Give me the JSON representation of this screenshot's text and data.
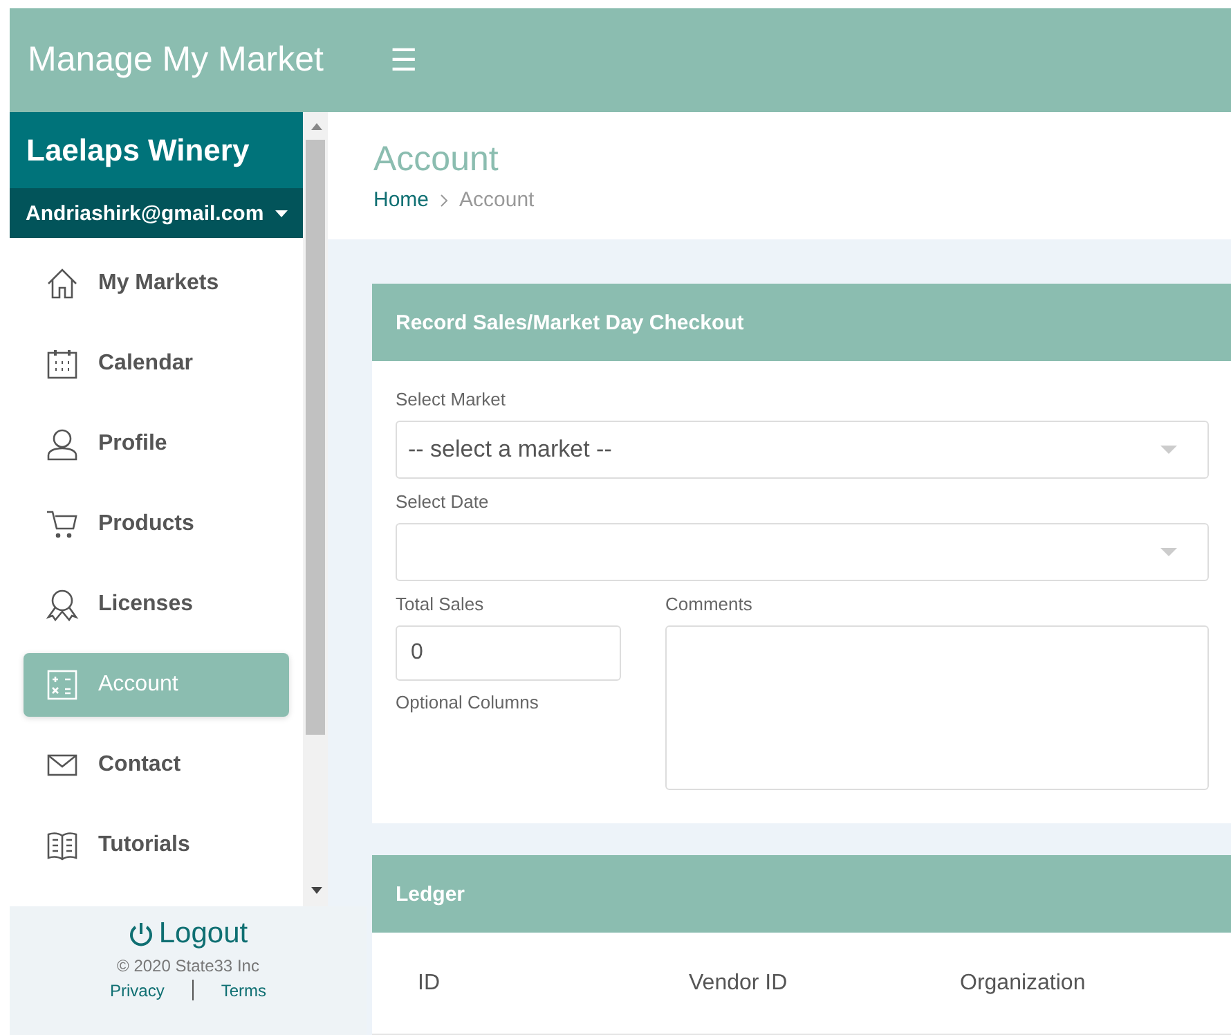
{
  "header": {
    "title": "Manage My Market",
    "menu_icon": "☰"
  },
  "sidebar": {
    "org": "Laelaps Winery",
    "email": "Andriashirk@gmail.com",
    "items": [
      {
        "label": "My Markets",
        "selected": false
      },
      {
        "label": "Calendar",
        "selected": false
      },
      {
        "label": "Profile",
        "selected": false
      },
      {
        "label": "Products",
        "selected": false
      },
      {
        "label": "Licenses",
        "selected": false
      },
      {
        "label": "Account",
        "selected": true
      },
      {
        "label": "Contact",
        "selected": false
      },
      {
        "label": "Tutorials",
        "selected": false
      }
    ],
    "logout": "Logout",
    "copyright": "© 2020 State33 Inc",
    "links": [
      "Privacy",
      "Terms"
    ]
  },
  "page": {
    "title": "Account",
    "breadcrumb": [
      "Home",
      "Account"
    ]
  },
  "sales_card": {
    "title": "Record Sales/Market Day Checkout",
    "market_label": "Select Market",
    "market_value": "-- select a market --",
    "date_label": "Select Date",
    "total_label": "Total Sales",
    "total_value": "0",
    "optional_label": "Optional Columns",
    "comments_label": "Comments"
  },
  "ledger": {
    "title": "Ledger",
    "columns": [
      "ID",
      "Vendor ID",
      "Organization"
    ]
  }
}
